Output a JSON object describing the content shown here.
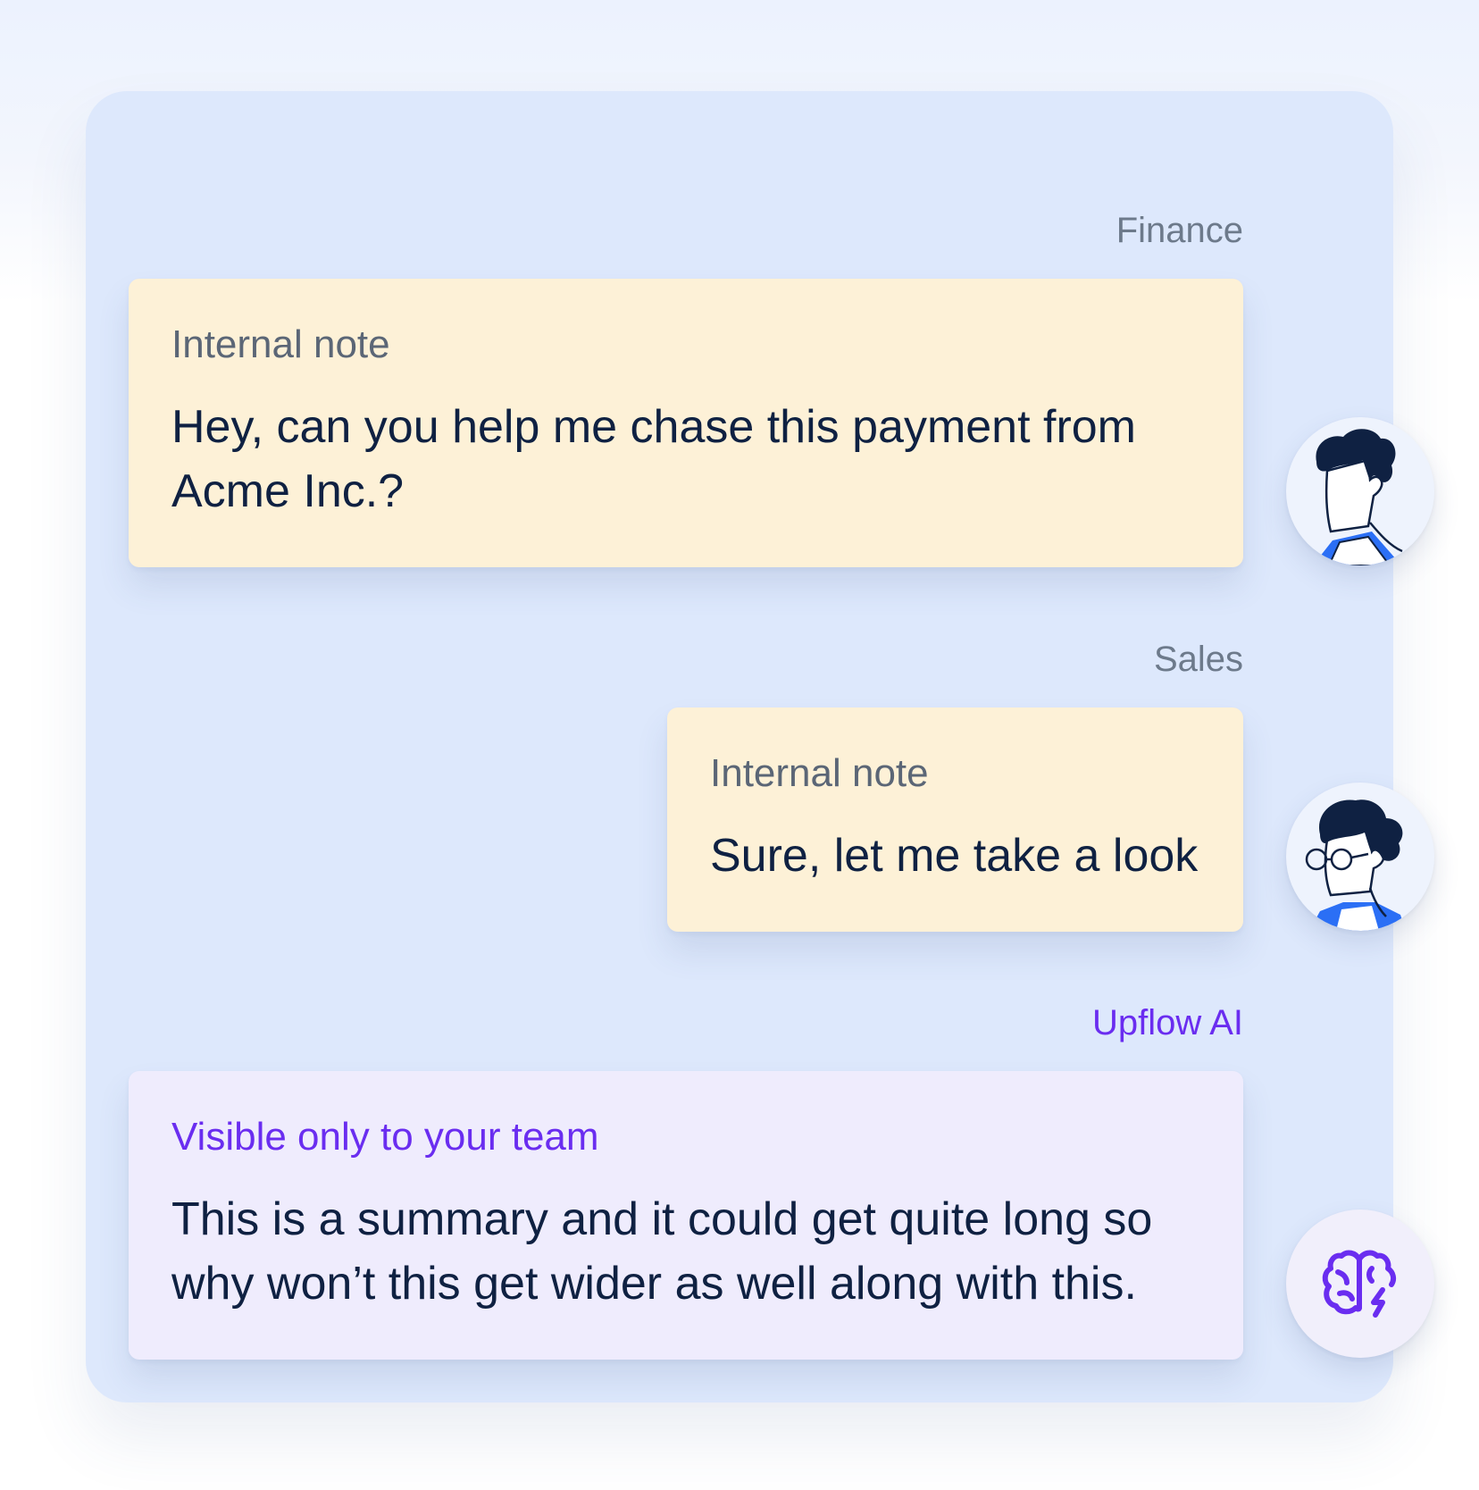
{
  "messages": [
    {
      "sender": "Finance",
      "label": "Internal note",
      "text": "Hey, can you help me chase this payment from Acme Inc.?",
      "avatar": "person-avatar-icon"
    },
    {
      "sender": "Sales",
      "label": "Internal note",
      "text": "Sure, let me take a look",
      "avatar": "person-with-glasses-avatar-icon"
    },
    {
      "sender": "Upflow AI",
      "label": "Visible only to your team",
      "text": "This is a summary and it could get quite long so why won’t this get wider as well along with this.",
      "avatar": "ai-brain-icon"
    }
  ],
  "colors": {
    "note_background": "#fdf1d7",
    "ai_background": "#efecfd",
    "ai_accent": "#6a2df0",
    "avatar_shirt": "#2b6ff5",
    "hair": "#0f2142"
  }
}
